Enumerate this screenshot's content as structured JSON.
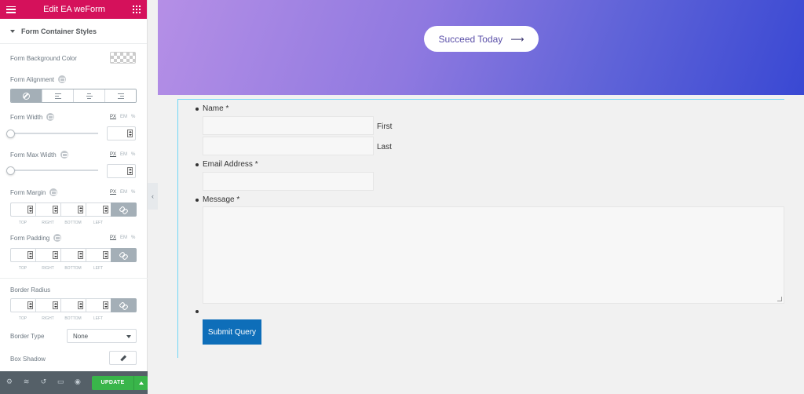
{
  "editor": {
    "title": "Edit EA weForm",
    "section_title": "Form Container Styles",
    "controls": {
      "bg_color_label": "Form Background Color",
      "alignment_label": "Form Alignment",
      "width_label": "Form Width",
      "max_width_label": "Form Max Width",
      "margin_label": "Form Margin",
      "padding_label": "Form Padding",
      "border_radius_label": "Border Radius",
      "border_type_label": "Border Type",
      "border_type_value": "None",
      "box_shadow_label": "Box Shadow"
    },
    "units": [
      "PX",
      "EM",
      "%"
    ],
    "dimension_labels": [
      "TOP",
      "RIGHT",
      "BOTTOM",
      "LEFT"
    ],
    "update_label": "UPDATE",
    "collapse_glyph": "‹",
    "bottom_icons": {
      "settings": "⚙",
      "layers": "≋",
      "history": "↺",
      "responsive": "▭",
      "preview": "◉"
    }
  },
  "preview": {
    "cta_label": "Succeed Today",
    "cta_arrow": "⟶",
    "form": {
      "name_label": "Name *",
      "first_label": "First",
      "last_label": "Last",
      "email_label": "Email Address *",
      "message_label": "Message *",
      "submit_label": "Submit Query"
    }
  },
  "colors": {
    "topbar": "#d5115b",
    "update_button": "#39b54a",
    "submit_button": "#0e6eb9",
    "hero_gradient_start": "#b58fe6",
    "hero_gradient_end": "#3948d3"
  }
}
